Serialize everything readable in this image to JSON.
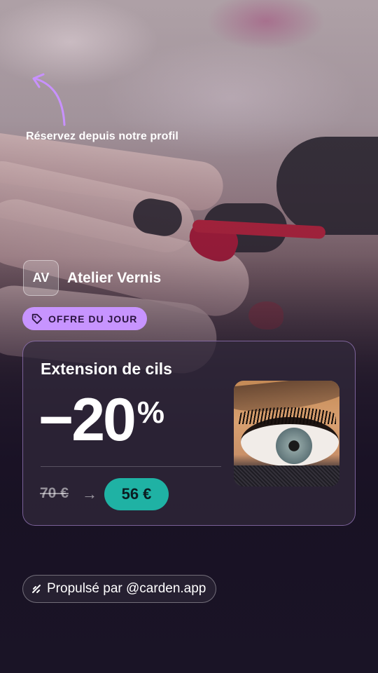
{
  "hint": {
    "text": "Réservez depuis notre profil"
  },
  "brand": {
    "initials": "AV",
    "name": "Atelier Vernis"
  },
  "offer_pill": {
    "label": "OFFRE DU JOUR",
    "color": "#c794ff"
  },
  "card": {
    "title": "Extension de cils",
    "discount_value": "−20",
    "discount_unit": "%",
    "old_price": "70 €",
    "arrow": "→",
    "new_price": "56 €",
    "new_price_color": "#1fb2a4",
    "border_color": "#be96eb"
  },
  "footer": {
    "label": "Propulsé par @carden.app"
  }
}
